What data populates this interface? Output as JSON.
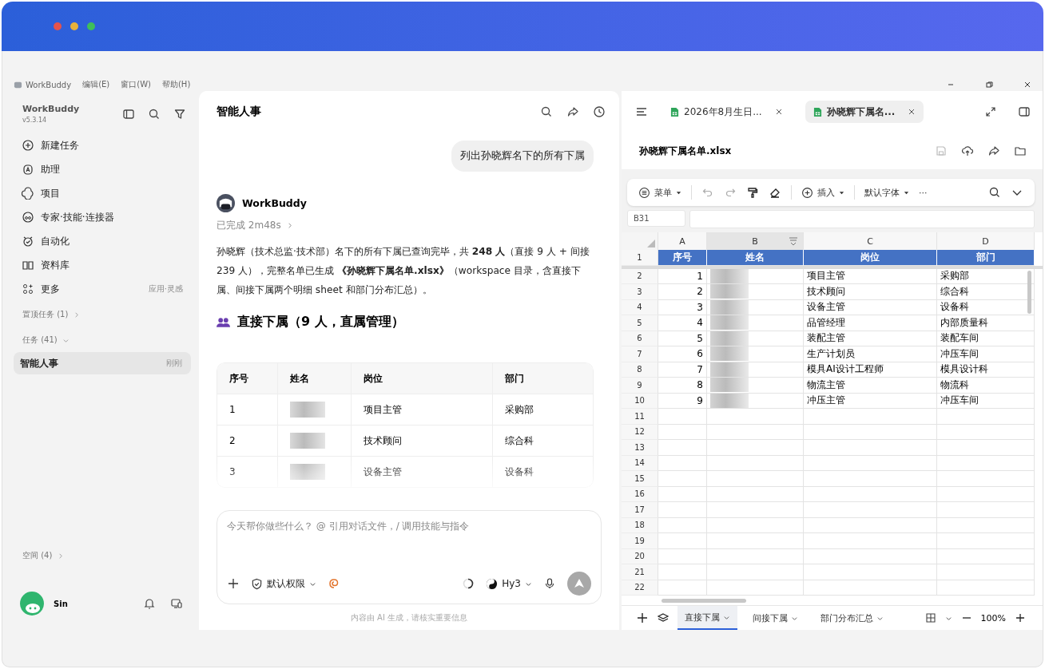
{
  "menu_bar": {
    "app_name": "WorkBuddy",
    "items": [
      "编辑(E)",
      "窗口(W)",
      "帮助(H)"
    ]
  },
  "sidebar": {
    "brand": "WorkBuddy",
    "version": "v5.3.14",
    "nav": [
      {
        "label": "新建任务"
      },
      {
        "label": "助理"
      },
      {
        "label": "项目"
      },
      {
        "label": "专家·技能·连接器"
      },
      {
        "label": "自动化"
      },
      {
        "label": "资料库"
      },
      {
        "label": "更多",
        "hint": "应用·灵感"
      }
    ],
    "pinned": {
      "label": "置顶任务 (1)",
      "expanded": false
    },
    "tasks": {
      "label": "任务 (41)",
      "expanded": true,
      "items": [
        {
          "title": "智能人事",
          "time": "刚刚",
          "selected": true
        }
      ]
    },
    "spaces": {
      "label": "空间 (4)",
      "expanded": false
    },
    "user": {
      "name": "Sin"
    }
  },
  "chat": {
    "title": "智能人事",
    "user_message": "列出孙晓辉名下的所有下属",
    "bot_name": "WorkBuddy",
    "status": "已完成 2m48s",
    "summary": "孙晓辉（技术总监·技术部）名下的所有下属已查询完毕，共 **248 人**（直接 9 人 + 间接 239 人），完整名单已生成 **《孙晓辉下属名单.xlsx》**（workspace 目录，含直接下属、间接下属两个明细 sheet 和部门分布汇总）。",
    "heading": "直接下属（9 人，直属管理）",
    "table": {
      "columns": [
        "序号",
        "姓名",
        "岗位",
        "部门"
      ],
      "rows": [
        {
          "index": "1",
          "position": "项目主管",
          "department": "采购部"
        },
        {
          "index": "2",
          "position": "技术顾问",
          "department": "综合科"
        },
        {
          "index": "3",
          "position": "设备主管",
          "department": "设备科"
        }
      ]
    },
    "composer": {
      "placeholder": "今天帮你做些什么？ @ 引用对话文件，/ 调用技能与指令",
      "permission": "默认权限",
      "model": "Hy3"
    },
    "disclaimer": "内容由 AI 生成，请核实重要信息"
  },
  "viewer": {
    "tabs": [
      {
        "label": "2026年8月生日...",
        "selected": false
      },
      {
        "label": "孙晓辉下属名...",
        "selected": true
      }
    ],
    "file_name": "孙晓辉下属名单.xlsx",
    "toolbar": {
      "menu": "菜单",
      "insert": "插入",
      "font": "默认字体",
      "more": "···"
    },
    "name_box": "B31",
    "columns": [
      {
        "label": "A",
        "selected": false
      },
      {
        "label": "B",
        "selected": true
      },
      {
        "label": "C",
        "selected": false
      },
      {
        "label": "D",
        "selected": false
      }
    ],
    "header_row": {
      "row": "1",
      "cells": [
        "序号",
        "姓名",
        "岗位",
        "部门"
      ]
    },
    "rows": [
      {
        "row": "2",
        "index": "1",
        "position": "项目主管",
        "department": "采购部"
      },
      {
        "row": "3",
        "index": "2",
        "position": "技术顾问",
        "department": "综合科"
      },
      {
        "row": "4",
        "index": "3",
        "position": "设备主管",
        "department": "设备科"
      },
      {
        "row": "5",
        "index": "4",
        "position": "品管经理",
        "department": "内部质量科"
      },
      {
        "row": "6",
        "index": "5",
        "position": "装配主管",
        "department": "装配车间"
      },
      {
        "row": "7",
        "index": "6",
        "position": "生产计划员",
        "department": "冲压车间"
      },
      {
        "row": "8",
        "index": "7",
        "position": "模具AI设计工程师",
        "department": "模具设计科"
      },
      {
        "row": "9",
        "index": "8",
        "position": "物流主管",
        "department": "物流科"
      },
      {
        "row": "10",
        "index": "9",
        "position": "冲压主管",
        "department": "冲压车间"
      }
    ],
    "empty_rows": [
      "11",
      "12",
      "13",
      "14",
      "15",
      "16",
      "17",
      "18",
      "19",
      "20",
      "21",
      "22"
    ],
    "sheet_tabs": [
      {
        "label": "直接下属",
        "selected": true
      },
      {
        "label": "间接下属",
        "selected": false
      },
      {
        "label": "部门分布汇总",
        "selected": false
      }
    ],
    "zoom": "100%"
  }
}
